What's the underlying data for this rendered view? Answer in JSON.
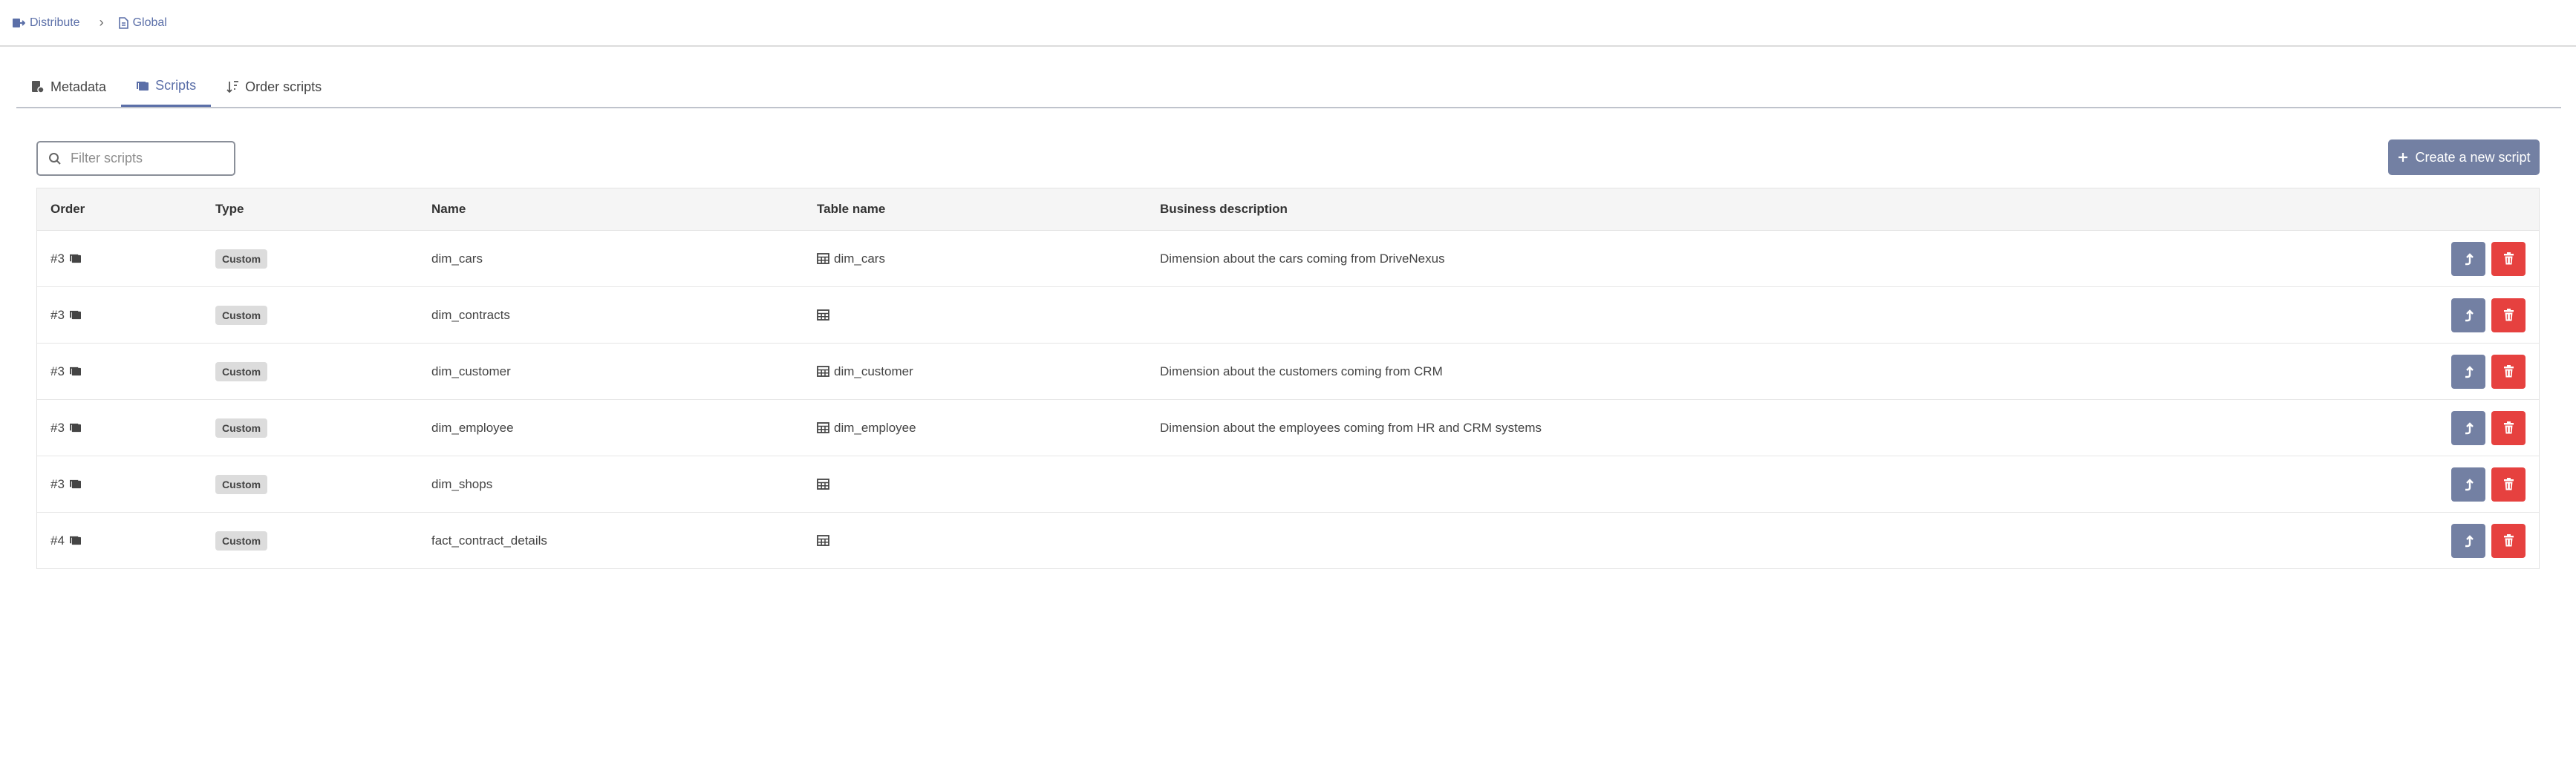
{
  "breadcrumb": {
    "items": [
      "Distribute",
      "Global"
    ]
  },
  "tabs": [
    {
      "label": "Metadata",
      "icon": "metadata-icon",
      "active": false
    },
    {
      "label": "Scripts",
      "icon": "scripts-icon",
      "active": true
    },
    {
      "label": "Order scripts",
      "icon": "sort-icon",
      "active": false
    }
  ],
  "filter": {
    "placeholder": "Filter scripts",
    "value": ""
  },
  "create_button": {
    "label": "Create a new script"
  },
  "table": {
    "headers": [
      "Order",
      "Type",
      "Name",
      "Table name",
      "Business description"
    ],
    "rows": [
      {
        "order": "#3",
        "type": "Custom",
        "name": "dim_cars",
        "table": "dim_cars",
        "description": "Dimension about the cars coming from DriveNexus"
      },
      {
        "order": "#3",
        "type": "Custom",
        "name": "dim_contracts",
        "table": "",
        "description": ""
      },
      {
        "order": "#3",
        "type": "Custom",
        "name": "dim_customer",
        "table": "dim_customer",
        "description": "Dimension about the customers coming from CRM"
      },
      {
        "order": "#3",
        "type": "Custom",
        "name": "dim_employee",
        "table": "dim_employee",
        "description": "Dimension about the employees coming from HR and CRM systems"
      },
      {
        "order": "#3",
        "type": "Custom",
        "name": "dim_shops",
        "table": "",
        "description": ""
      },
      {
        "order": "#4",
        "type": "Custom",
        "name": "fact_contract_details",
        "table": "",
        "description": ""
      }
    ]
  },
  "colors": {
    "accent": "#5b6fa8",
    "button": "#7380a3",
    "danger": "#e6413f"
  }
}
